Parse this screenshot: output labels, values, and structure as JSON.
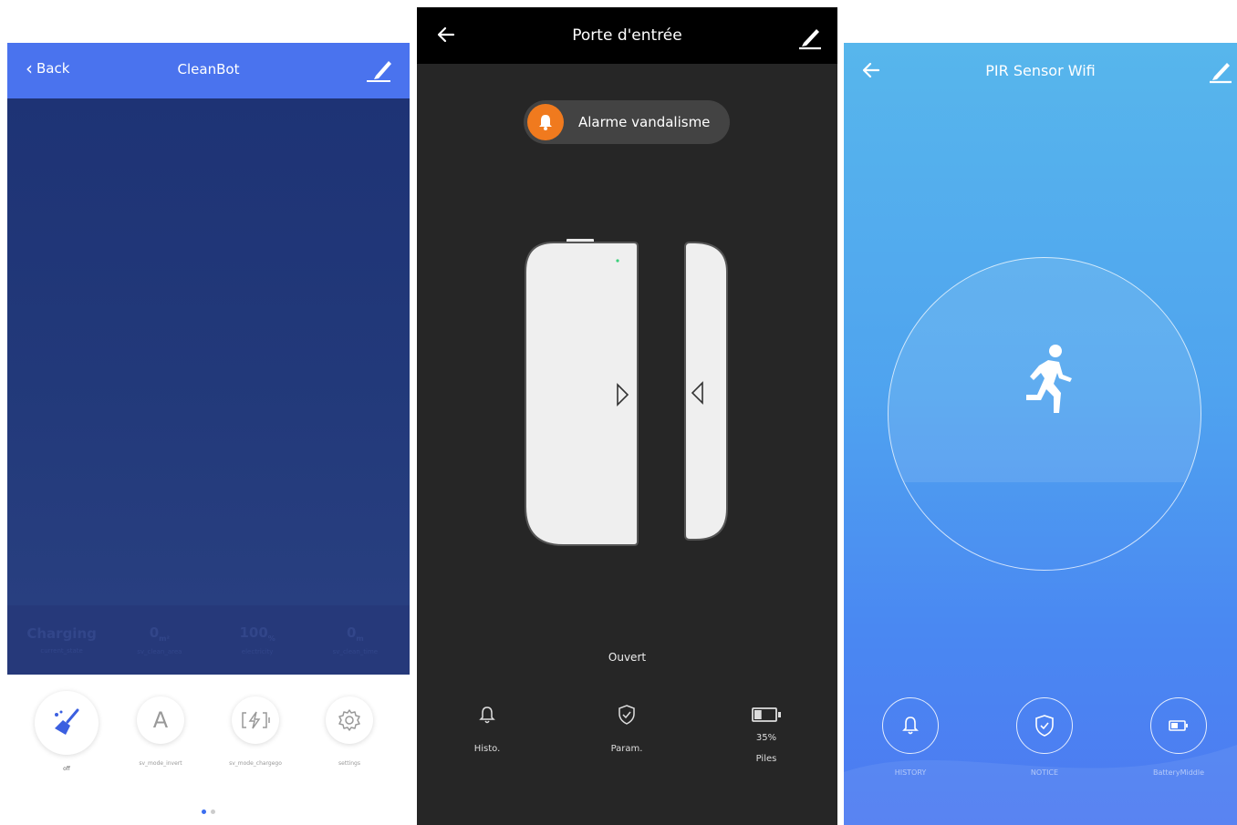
{
  "cleanbot": {
    "back_label": "Back",
    "title": "CleanBot",
    "stats": [
      {
        "value": "Charging",
        "label": "current_state"
      },
      {
        "value": "0",
        "unit": "m²",
        "label": "sv_clean_area"
      },
      {
        "value": "100",
        "unit": "%",
        "label": "electricity"
      },
      {
        "value": "0",
        "unit": "m",
        "label": "sv_clean_time"
      }
    ],
    "actions": [
      {
        "label": "off",
        "icon": "broom-icon"
      },
      {
        "label": "sv_mode_invert",
        "icon": "letter-a-icon"
      },
      {
        "label": "sv_mode_chargego",
        "icon": "charge-icon"
      },
      {
        "label": "settings",
        "icon": "gear-icon"
      }
    ],
    "page_dots": {
      "count": 2,
      "active": 1
    },
    "colors": {
      "header": "#4a73ee",
      "canvas": "#22397a",
      "accent": "#3b6ef0"
    }
  },
  "door_sensor": {
    "title": "Porte d'entrée",
    "alarm_label": "Alarme vandalisme",
    "state": "Ouvert",
    "bottom": [
      {
        "label": "Histo.",
        "icon": "bell-icon"
      },
      {
        "label": "Param.",
        "icon": "shield-icon"
      },
      {
        "label": "Piles",
        "percent": "35%",
        "icon": "battery-icon"
      }
    ],
    "colors": {
      "background": "#262626",
      "header": "#000000",
      "alarm": "#f07a1e"
    }
  },
  "pir_sensor": {
    "title": "PIR Sensor Wifi",
    "status_icon": "running-person-icon",
    "buttons": [
      {
        "label": "HISTORY",
        "icon": "bell-icon"
      },
      {
        "label": "NOTICE",
        "icon": "shield-icon"
      },
      {
        "label": "BatteryMiddle",
        "icon": "battery-icon"
      }
    ],
    "colors": {
      "gradient_top": "#57b6ec",
      "gradient_bottom": "#4d7af1"
    }
  }
}
